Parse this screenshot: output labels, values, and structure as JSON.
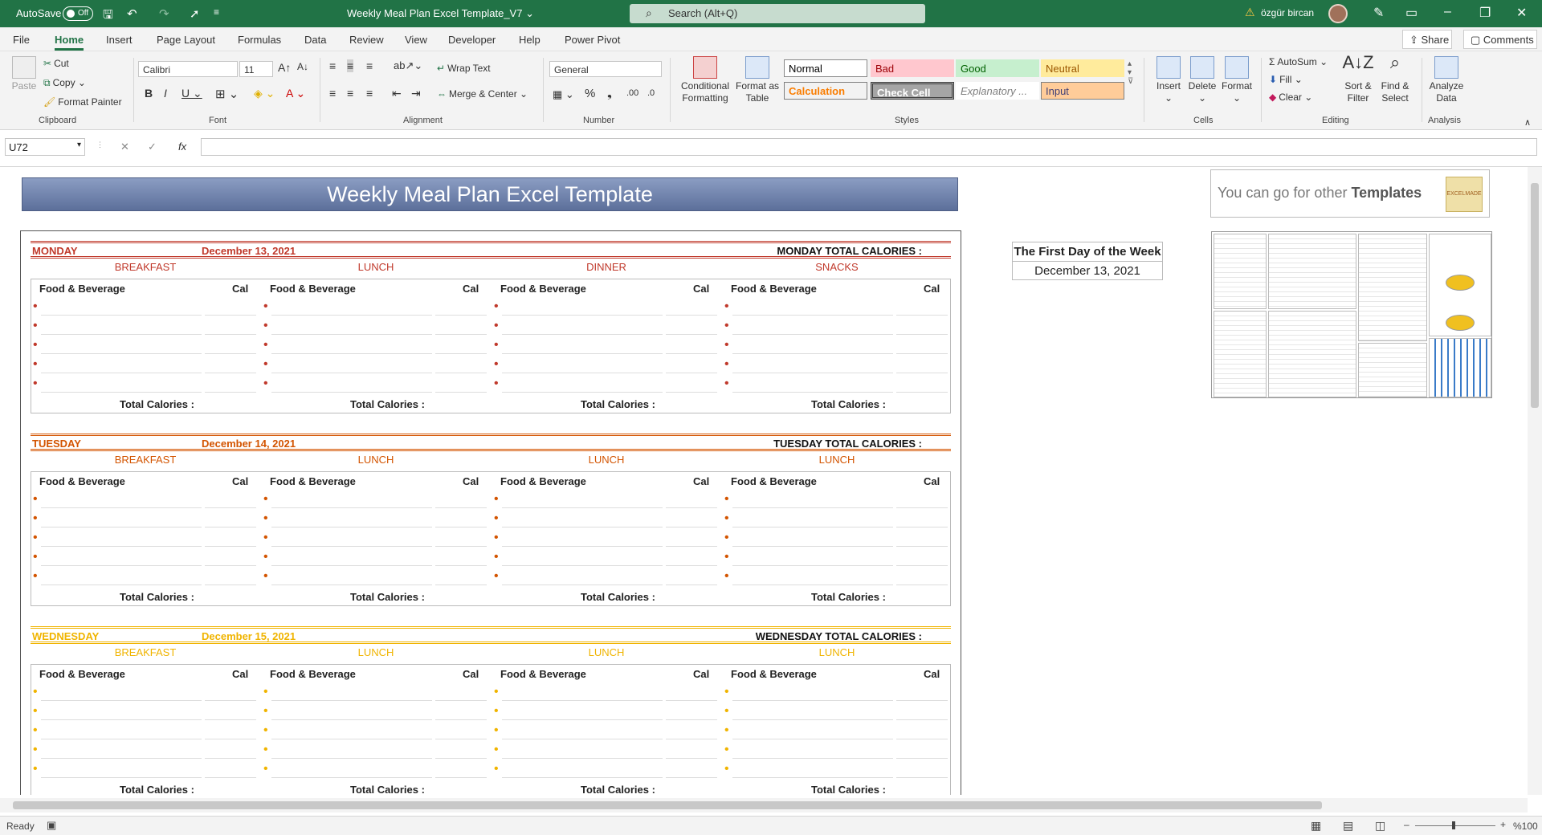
{
  "titlebar": {
    "autosave": "AutoSave",
    "toggle": "Off",
    "doc_title": "Weekly Meal Plan Excel Template_V7 ⌄",
    "search_placeholder": "Search (Alt+Q)",
    "user": "özgür bircan"
  },
  "menu": {
    "tabs": [
      "File",
      "Home",
      "Insert",
      "Page Layout",
      "Formulas",
      "Data",
      "Review",
      "View",
      "Developer",
      "Help",
      "Power Pivot"
    ],
    "active": "Home",
    "share": "Share",
    "comments": "Comments"
  },
  "ribbon": {
    "clipboard": {
      "paste": "Paste",
      "cut": "Cut",
      "copy": "Copy",
      "format_painter": "Format Painter",
      "label": "Clipboard"
    },
    "font": {
      "name": "Calibri",
      "size": "11",
      "label": "Font"
    },
    "alignment": {
      "wrap": "Wrap Text",
      "merge": "Merge & Center",
      "label": "Alignment"
    },
    "number": {
      "format": "General",
      "label": "Number"
    },
    "styles": {
      "conditional": "Conditional Formatting",
      "format_table": "Format as Table",
      "label": "Styles",
      "cells": [
        {
          "text": "Normal"
        },
        {
          "text": "Bad"
        },
        {
          "text": "Good"
        },
        {
          "text": "Neutral"
        },
        {
          "text": "Calculation"
        },
        {
          "text": "Check Cell"
        },
        {
          "text": "Explanatory ..."
        },
        {
          "text": "Input"
        }
      ]
    },
    "cells": {
      "insert": "Insert",
      "delete": "Delete",
      "format": "Format",
      "label": "Cells"
    },
    "editing": {
      "autosum": "AutoSum",
      "fill": "Fill",
      "clear": "Clear",
      "sort": "Sort & Filter",
      "find": "Find & Select",
      "label": "Editing"
    },
    "analysis": {
      "analyze": "Analyze Data",
      "label": "Analysis"
    }
  },
  "formula_bar": {
    "cell_ref": "U72",
    "fx": "fx",
    "formula": ""
  },
  "sheet": {
    "banner": "Weekly Meal Plan Excel Template",
    "promo_text": "You can go for other ",
    "promo_bold": "Templates",
    "promo_logo": "EXCELMADE",
    "first_day_title": "The First Day of the Week",
    "first_day_date": "December 13, 2021",
    "col_food": "Food & Beverage",
    "col_cal": "Cal",
    "total_label": "Total Calories :",
    "days": [
      {
        "name": "MONDAY",
        "date": "December 13, 2021",
        "total": "MONDAY TOTAL CALORIES :",
        "color": "#c0392b",
        "meals": [
          "BREAKFAST",
          "LUNCH",
          "DINNER",
          "SNACKS"
        ]
      },
      {
        "name": "TUESDAY",
        "date": "December 14, 2021",
        "total": "TUESDAY TOTAL CALORIES :",
        "color": "#d35400",
        "meals": [
          "BREAKFAST",
          "LUNCH",
          "LUNCH",
          "LUNCH"
        ]
      },
      {
        "name": "WEDNESDAY",
        "date": "December 15, 2021",
        "total": "WEDNESDAY TOTAL CALORIES :",
        "color": "#f0b400",
        "meals": [
          "BREAKFAST",
          "LUNCH",
          "LUNCH",
          "LUNCH"
        ]
      }
    ]
  },
  "status": {
    "ready": "Ready",
    "zoom": "%100"
  }
}
